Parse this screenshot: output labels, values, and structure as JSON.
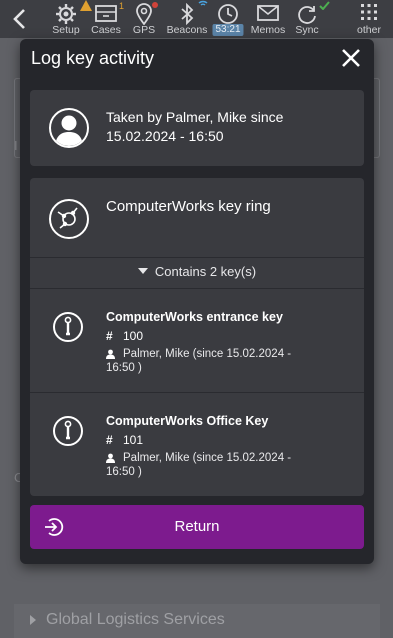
{
  "topbar": {
    "items": [
      {
        "label": "Setup",
        "icon": "gear-icon",
        "badge": "!",
        "badge_color": "#e0a030"
      },
      {
        "label": "Cases",
        "icon": "box-icon",
        "badge": "1",
        "badge_color": "#e0a030"
      },
      {
        "label": "GPS",
        "icon": "location-pin-icon",
        "badge_color": "#d0433a"
      },
      {
        "label": "Beacons",
        "icon": "bluetooth-icon",
        "badge_color": "#4aa3df"
      },
      {
        "label": "53:21",
        "icon": "clock-icon"
      },
      {
        "label": "Memos",
        "icon": "envelope-icon"
      },
      {
        "label": "Sync",
        "icon": "sync-icon",
        "badge_color": "#4caf50"
      },
      {
        "label": "other",
        "icon": "grid-icon"
      }
    ]
  },
  "background": {
    "letter1": "I",
    "letter2": "C",
    "row_label": "Global Logistics Services"
  },
  "modal": {
    "title": "Log key activity",
    "taken_text": "Taken by Palmer, Mike since 15.02.2024 - 16:50",
    "ring": {
      "name": "ComputerWorks key ring",
      "contains": "Contains 2 key(s)",
      "keys": [
        {
          "name": "ComputerWorks entrance key",
          "number": "100",
          "holder_l1": "Palmer, Mike (since 15.02.2024 -",
          "holder_l2": "16:50 )"
        },
        {
          "name": "ComputerWorks Office Key",
          "number": "101",
          "holder_l1": "Palmer, Mike (since 15.02.2024 -",
          "holder_l2": "16:50 )"
        }
      ]
    },
    "return_label": "Return",
    "accent": "#7d1b8e"
  },
  "symbols": {
    "hash": "#"
  }
}
